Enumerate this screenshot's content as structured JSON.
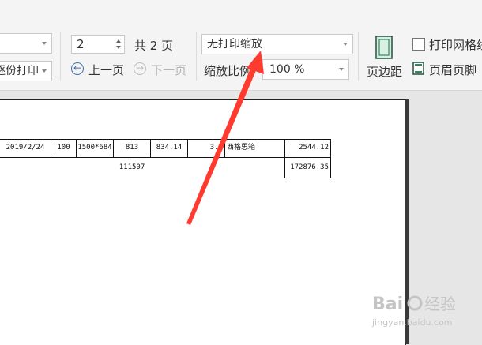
{
  "toolbar": {
    "print_combo_label": "逐份打印",
    "page_number": "2",
    "total_pages": "共 2 页",
    "prev_page": "上一页",
    "next_page": "下一页",
    "scale_mode": "无打印缩放",
    "scale_ratio_label": "缩放比例",
    "scale_value": "100 %",
    "margins_label": "页边距",
    "print_grid_label": "打印网格线",
    "header_footer_label": "页眉页脚"
  },
  "sheet": {
    "row1": [
      "2019/2/24",
      "100",
      "1500*684",
      "813",
      "834.14",
      "3.0",
      "西格思箱",
      "2544.12"
    ],
    "row2_total_mid": "111507",
    "row2_total_right": "172876.35"
  },
  "colors": {
    "annotation_arrow": "#ff3b30"
  },
  "icons": [
    "prev-page-icon",
    "next-page-icon",
    "margins-icon",
    "header-footer-icon"
  ]
}
